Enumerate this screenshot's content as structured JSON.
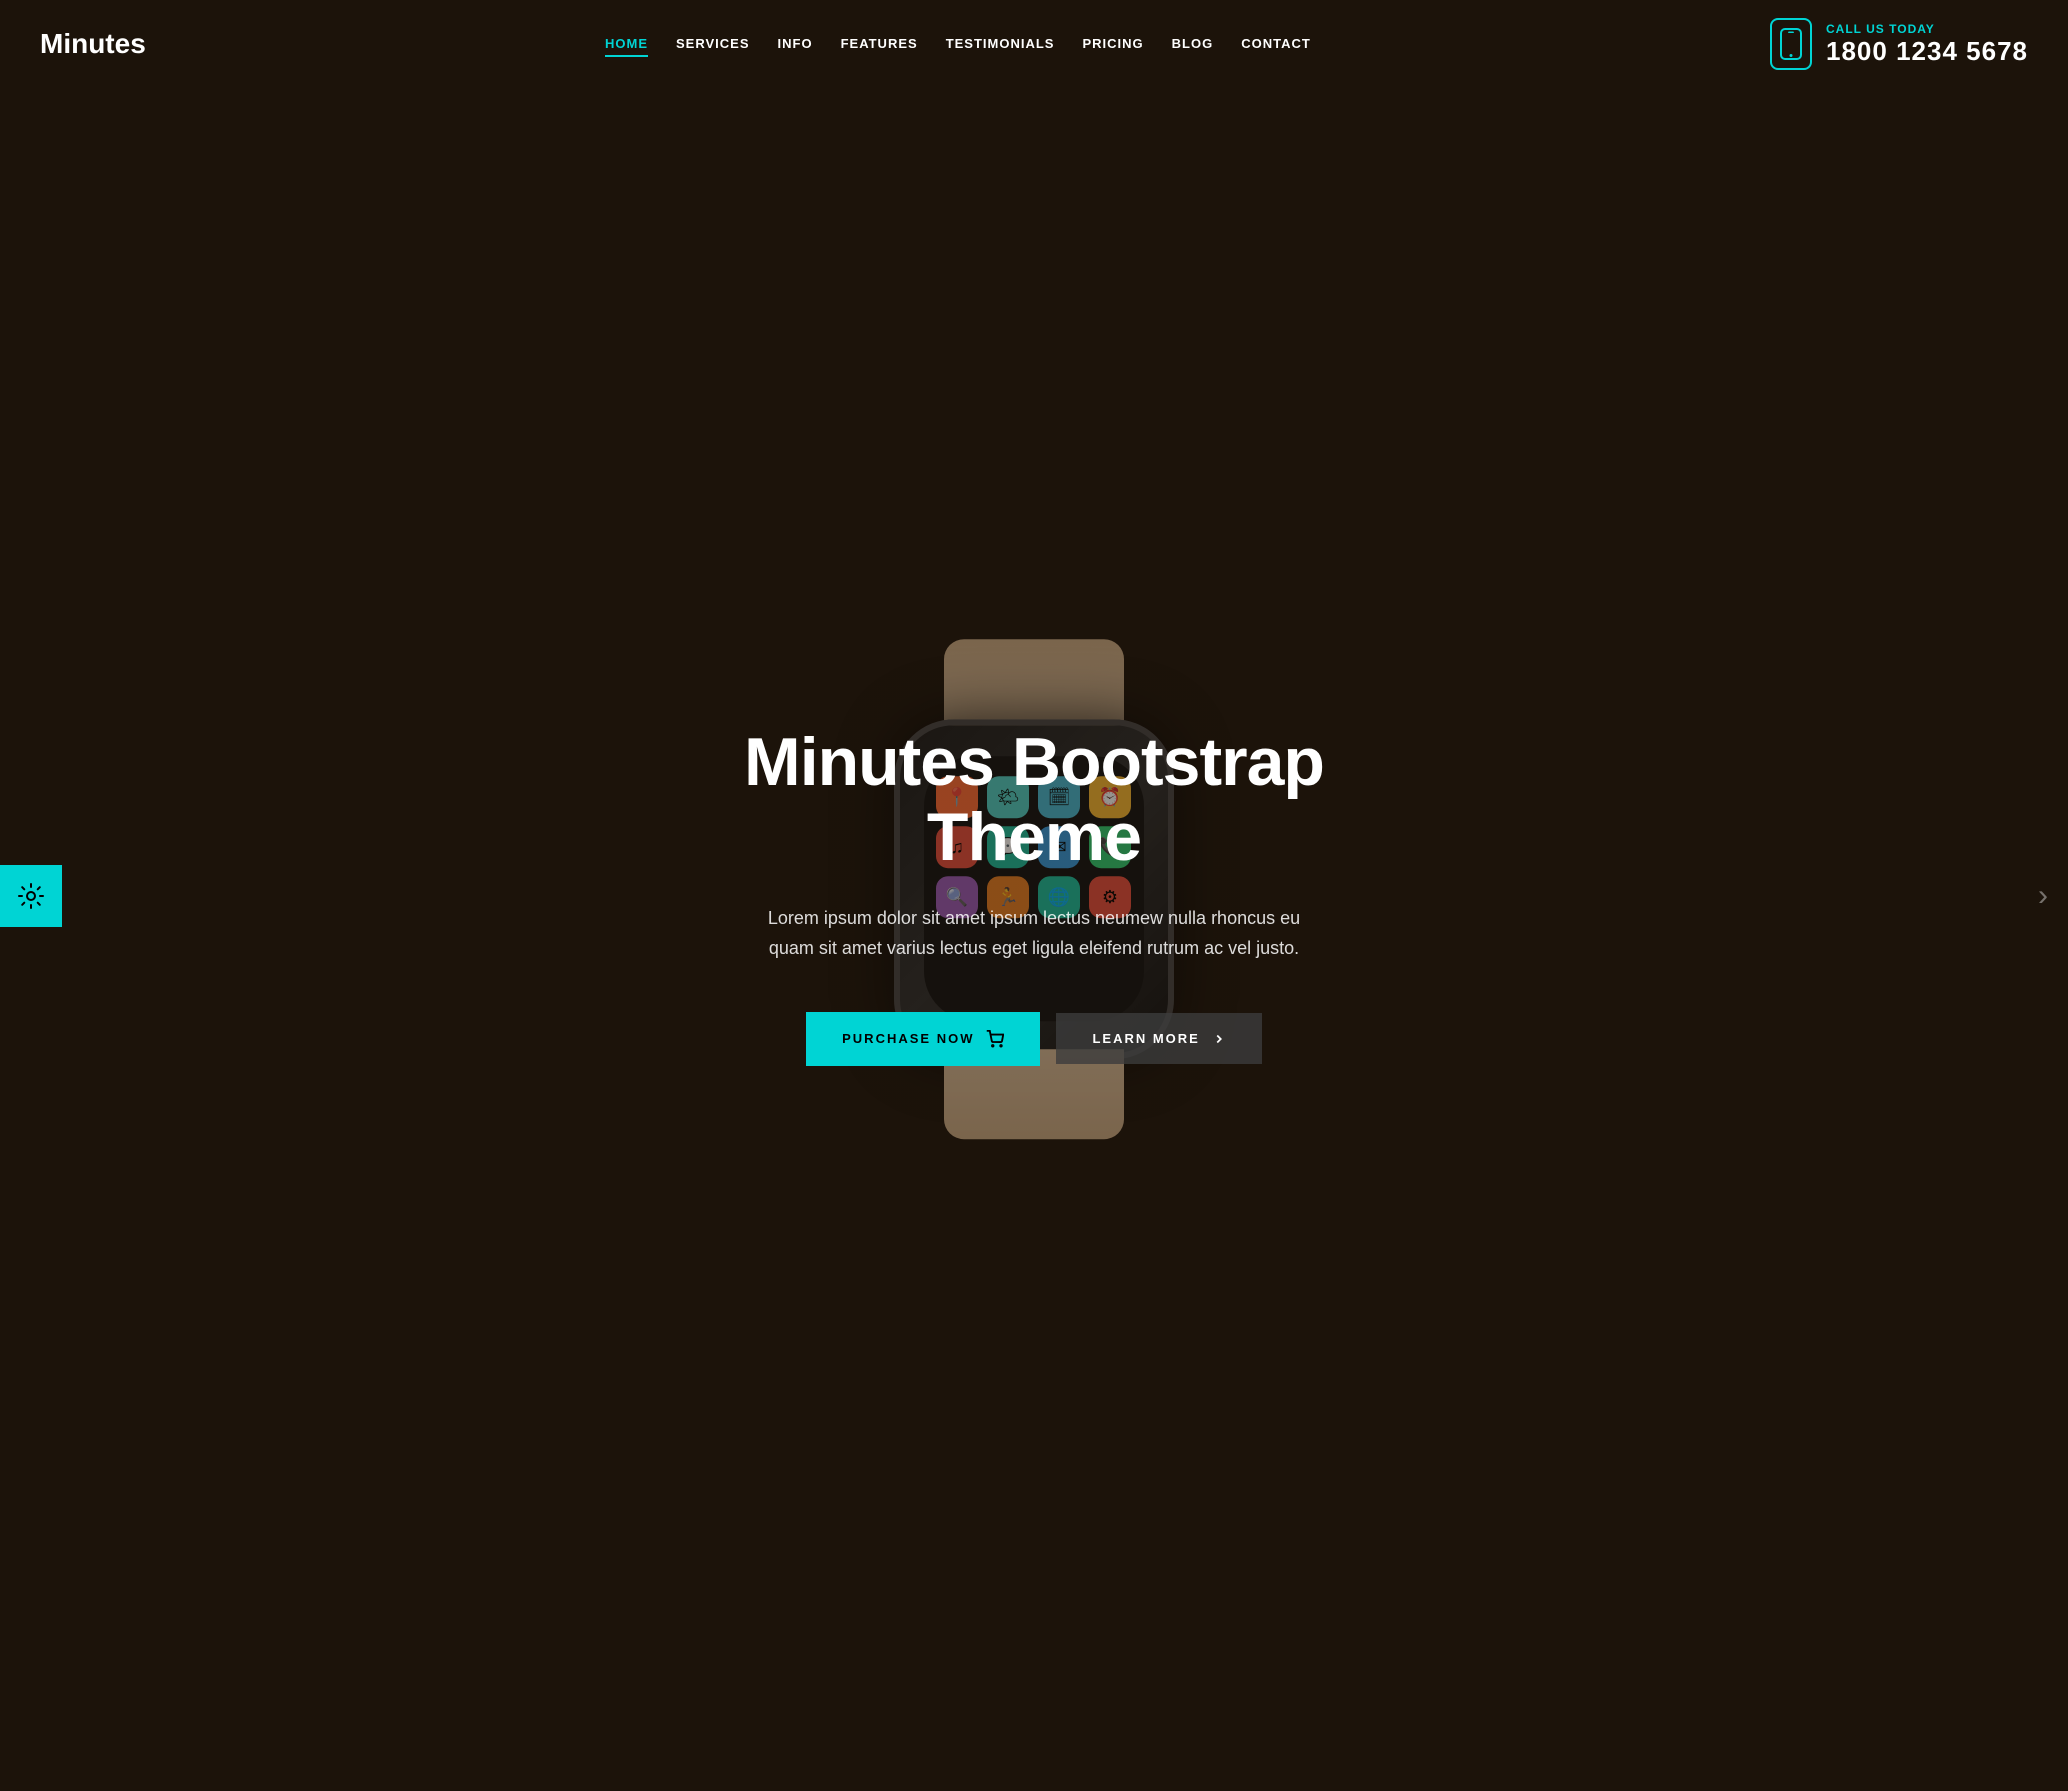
{
  "brand": {
    "logo": "Minutes"
  },
  "header": {
    "nav": [
      {
        "label": "HOME",
        "active": true
      },
      {
        "label": "SERVICES",
        "active": false
      },
      {
        "label": "INFO",
        "active": false
      },
      {
        "label": "FEATURES",
        "active": false
      },
      {
        "label": "TESTIMONIALS",
        "active": false
      },
      {
        "label": "PRICING",
        "active": false
      },
      {
        "label": "BLOG",
        "active": false
      },
      {
        "label": "CONTACT",
        "active": false
      }
    ],
    "phone": {
      "label": "CALL US TODAY",
      "number": "1800 1234 5678"
    }
  },
  "hero": {
    "title": "Minutes Bootstrap Theme",
    "description": "Lorem ipsum dolor sit amet ipsum lectus neumew nulla rhoncus eu quam sit amet varius lectus eget ligula eleifend rutrum ac vel justo.",
    "btn_purchase": "PURCHASE NOW",
    "btn_learn": "LEARN MORE"
  },
  "settings": {
    "icon": "⚙"
  },
  "colors": {
    "accent": "#00d4d4",
    "dark": "#1a1a1a",
    "overlay": "rgba(20,15,10,0.65)"
  }
}
